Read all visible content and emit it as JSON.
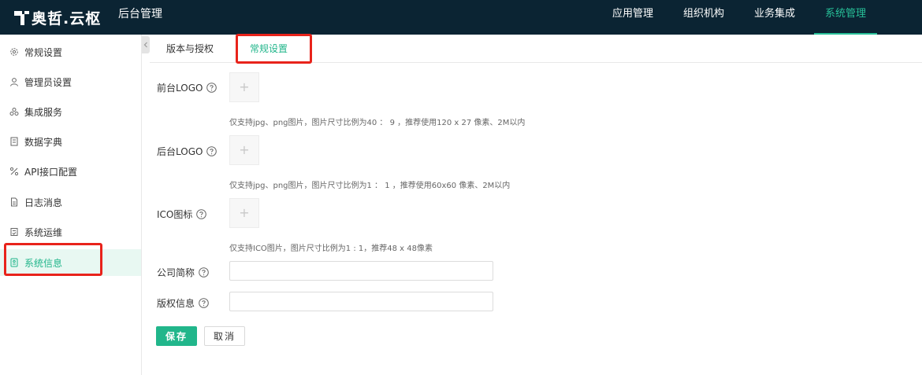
{
  "header": {
    "logo_text": "奥哲.云枢",
    "console_title": "后台管理",
    "nav": [
      {
        "label": "应用管理",
        "active": false
      },
      {
        "label": "组织机构",
        "active": false
      },
      {
        "label": "业务集成",
        "active": false
      },
      {
        "label": "系统管理",
        "active": true
      }
    ]
  },
  "sidebar": {
    "items": [
      {
        "label": "常规设置",
        "icon": "gear-icon"
      },
      {
        "label": "管理员设置",
        "icon": "user-icon"
      },
      {
        "label": "集成服务",
        "icon": "integration-icon"
      },
      {
        "label": "数据字典",
        "icon": "dictionary-icon"
      },
      {
        "label": "API接口配置",
        "icon": "api-icon"
      },
      {
        "label": "日志消息",
        "icon": "log-icon"
      },
      {
        "label": "系统运维",
        "icon": "maintenance-icon"
      },
      {
        "label": "系统信息",
        "icon": "system-info-icon",
        "active": true
      }
    ]
  },
  "tabs": [
    {
      "label": "版本与授权",
      "active": false
    },
    {
      "label": "常规设置",
      "active": true
    }
  ],
  "form": {
    "front_logo": {
      "label": "前台LOGO",
      "hint": "仅支持jpg、png图片，图片尺寸比例为40 ： 9 ，推荐使用120 x 27 像素、2M以内"
    },
    "back_logo": {
      "label": "后台LOGO",
      "hint": "仅支持jpg、png图片，图片尺寸比例为1 ： 1 ，推荐使用60x60 像素、2M以内"
    },
    "ico": {
      "label": "ICO图标",
      "hint": "仅支持ICO图片，图片尺寸比例为1 : 1，推荐48 x 48像素"
    },
    "company_name": {
      "label": "公司简称",
      "value": ""
    },
    "copyright": {
      "label": "版权信息",
      "value": ""
    },
    "save_label": "保存",
    "cancel_label": "取消"
  },
  "colors": {
    "topbar": "#0b2433",
    "accent": "#21b68b",
    "annotation": "#e8231b"
  }
}
